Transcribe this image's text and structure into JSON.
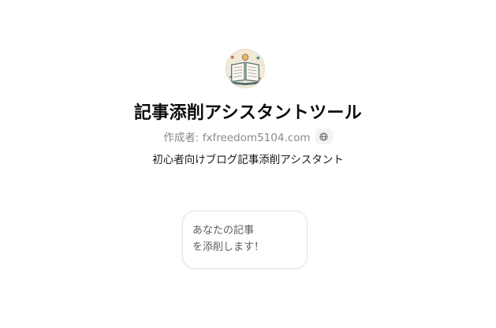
{
  "gpt": {
    "avatar_icon": "open-book-icon",
    "title": "記事添削アシスタントツール",
    "author_label": "作成者: fxfreedom5104.com",
    "author_link_icon": "globe-icon",
    "description": "初心者向けブログ記事添削アシスタント"
  },
  "conversation_starters": [
    {
      "lines": [
        "あなたの記事",
        "を添削します！"
      ]
    }
  ],
  "colors": {
    "title": "#0d0d0d",
    "author": "#8a8a8a",
    "card_border": "#e3e3e3",
    "card_text": "#5d5d5d"
  }
}
